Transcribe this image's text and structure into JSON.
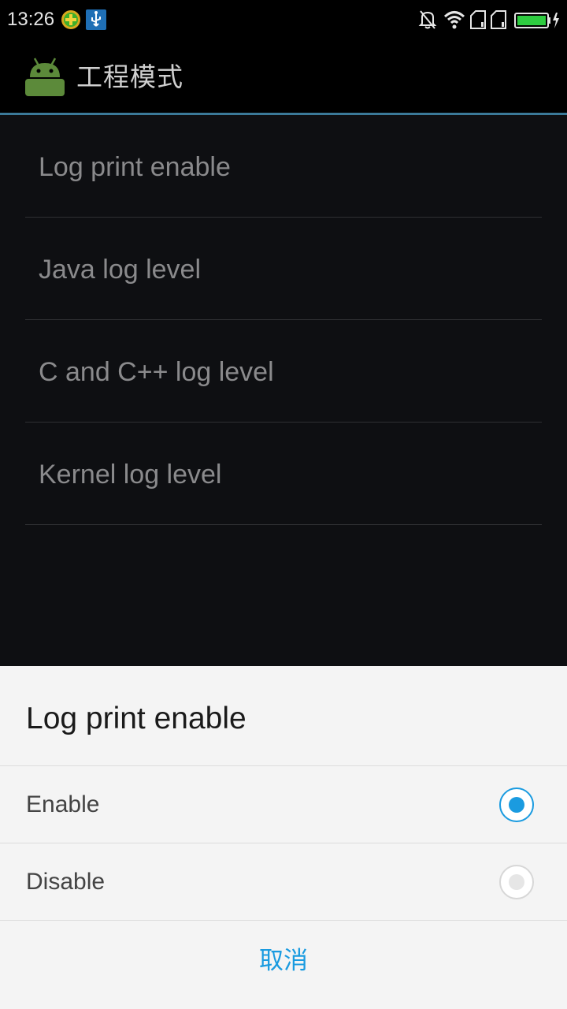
{
  "status_bar": {
    "time": "13:26",
    "icons": [
      "health-plus-icon",
      "usb-icon",
      "mute-notifications-icon",
      "wifi-icon",
      "sim-1-icon",
      "sim-2-icon",
      "battery-charging-icon"
    ],
    "battery_color": "#2ecc40"
  },
  "action_bar": {
    "title": "工程模式",
    "icon": "android-icon",
    "divider_color": "#3b7a99"
  },
  "list": {
    "items": [
      {
        "label": "Log print enable"
      },
      {
        "label": "Java log level"
      },
      {
        "label": "C and C++ log level"
      },
      {
        "label": "Kernel log level"
      }
    ]
  },
  "dialog": {
    "title": "Log print enable",
    "options": [
      {
        "label": "Enable",
        "selected": true
      },
      {
        "label": "Disable",
        "selected": false
      }
    ],
    "cancel_label": "取消",
    "accent_color": "#1a9be0"
  }
}
